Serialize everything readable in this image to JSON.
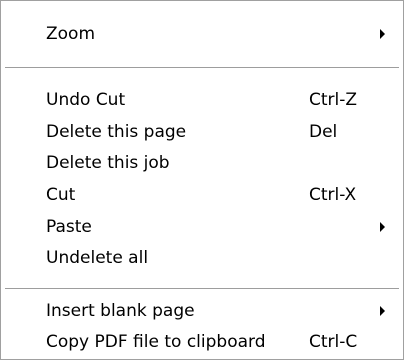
{
  "menu": {
    "groups": [
      [
        {
          "label": "Zoom",
          "shortcut": "",
          "submenu": true
        }
      ],
      [
        {
          "label": "Undo Cut",
          "shortcut": "Ctrl-Z",
          "submenu": false
        },
        {
          "label": "Delete this page",
          "shortcut": "Del",
          "submenu": false
        },
        {
          "label": "Delete this job",
          "shortcut": "",
          "submenu": false
        },
        {
          "label": "Cut",
          "shortcut": "Ctrl-X",
          "submenu": false
        },
        {
          "label": "Paste",
          "shortcut": "",
          "submenu": true
        },
        {
          "label": "Undelete all",
          "shortcut": "",
          "submenu": false
        }
      ],
      [
        {
          "label": "Insert blank page",
          "shortcut": "",
          "submenu": true
        },
        {
          "label": "Copy PDF file to clipboard",
          "shortcut": "Ctrl-C",
          "submenu": false
        }
      ]
    ]
  }
}
